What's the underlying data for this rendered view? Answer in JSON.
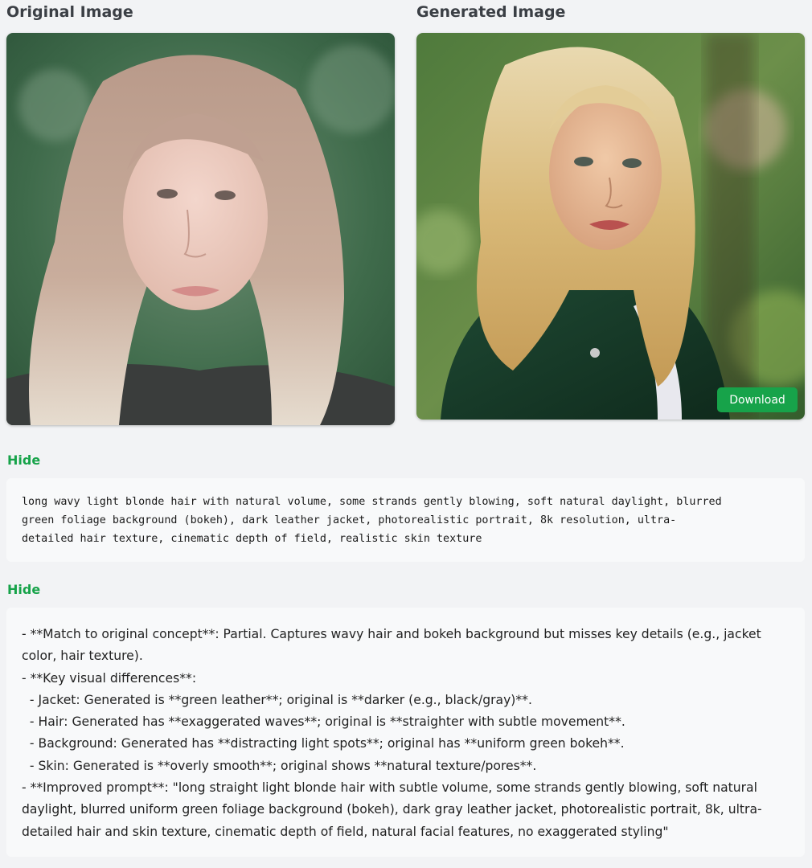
{
  "original": {
    "title": "Original Image"
  },
  "generated": {
    "title": "Generated Image",
    "download_label": "Download"
  },
  "prompt_section": {
    "toggle_label": "Hide",
    "text": "long wavy light blonde hair with natural volume, some strands gently blowing, soft natural daylight, blurred\ngreen foliage background (bokeh), dark leather jacket, photorealistic portrait, 8k resolution, ultra-\ndetailed hair texture, cinematic depth of field, realistic skin texture"
  },
  "analysis_section": {
    "toggle_label": "Hide",
    "lines": [
      "- **Match to original concept**: Partial. Captures wavy hair and bokeh background but misses key details (e.g., jacket",
      "color, hair texture).",
      "- **Key visual differences**:",
      "  - Jacket: Generated is **green leather**; original is **darker (e.g., black/gray)**.",
      "  - Hair: Generated has **exaggerated waves**; original is **straighter with subtle movement**.",
      "  - Background: Generated has **distracting light spots**; original has **uniform green bokeh**.",
      "  - Skin: Generated is **overly smooth**; original shows **natural texture/pores**.",
      "- **Improved prompt**: \"long straight light blonde hair with subtle volume, some strands gently blowing, soft natural",
      "daylight, blurred uniform green foliage background (bokeh), dark gray leather jacket, photorealistic portrait, 8k, ultra-",
      "detailed hair and skin texture, cinematic depth of field, natural facial features, no exaggerated styling\""
    ]
  },
  "colors": {
    "accent": "#17a34a",
    "background": "#f2f3f5",
    "panel": "#f8f9fa"
  },
  "icons": []
}
